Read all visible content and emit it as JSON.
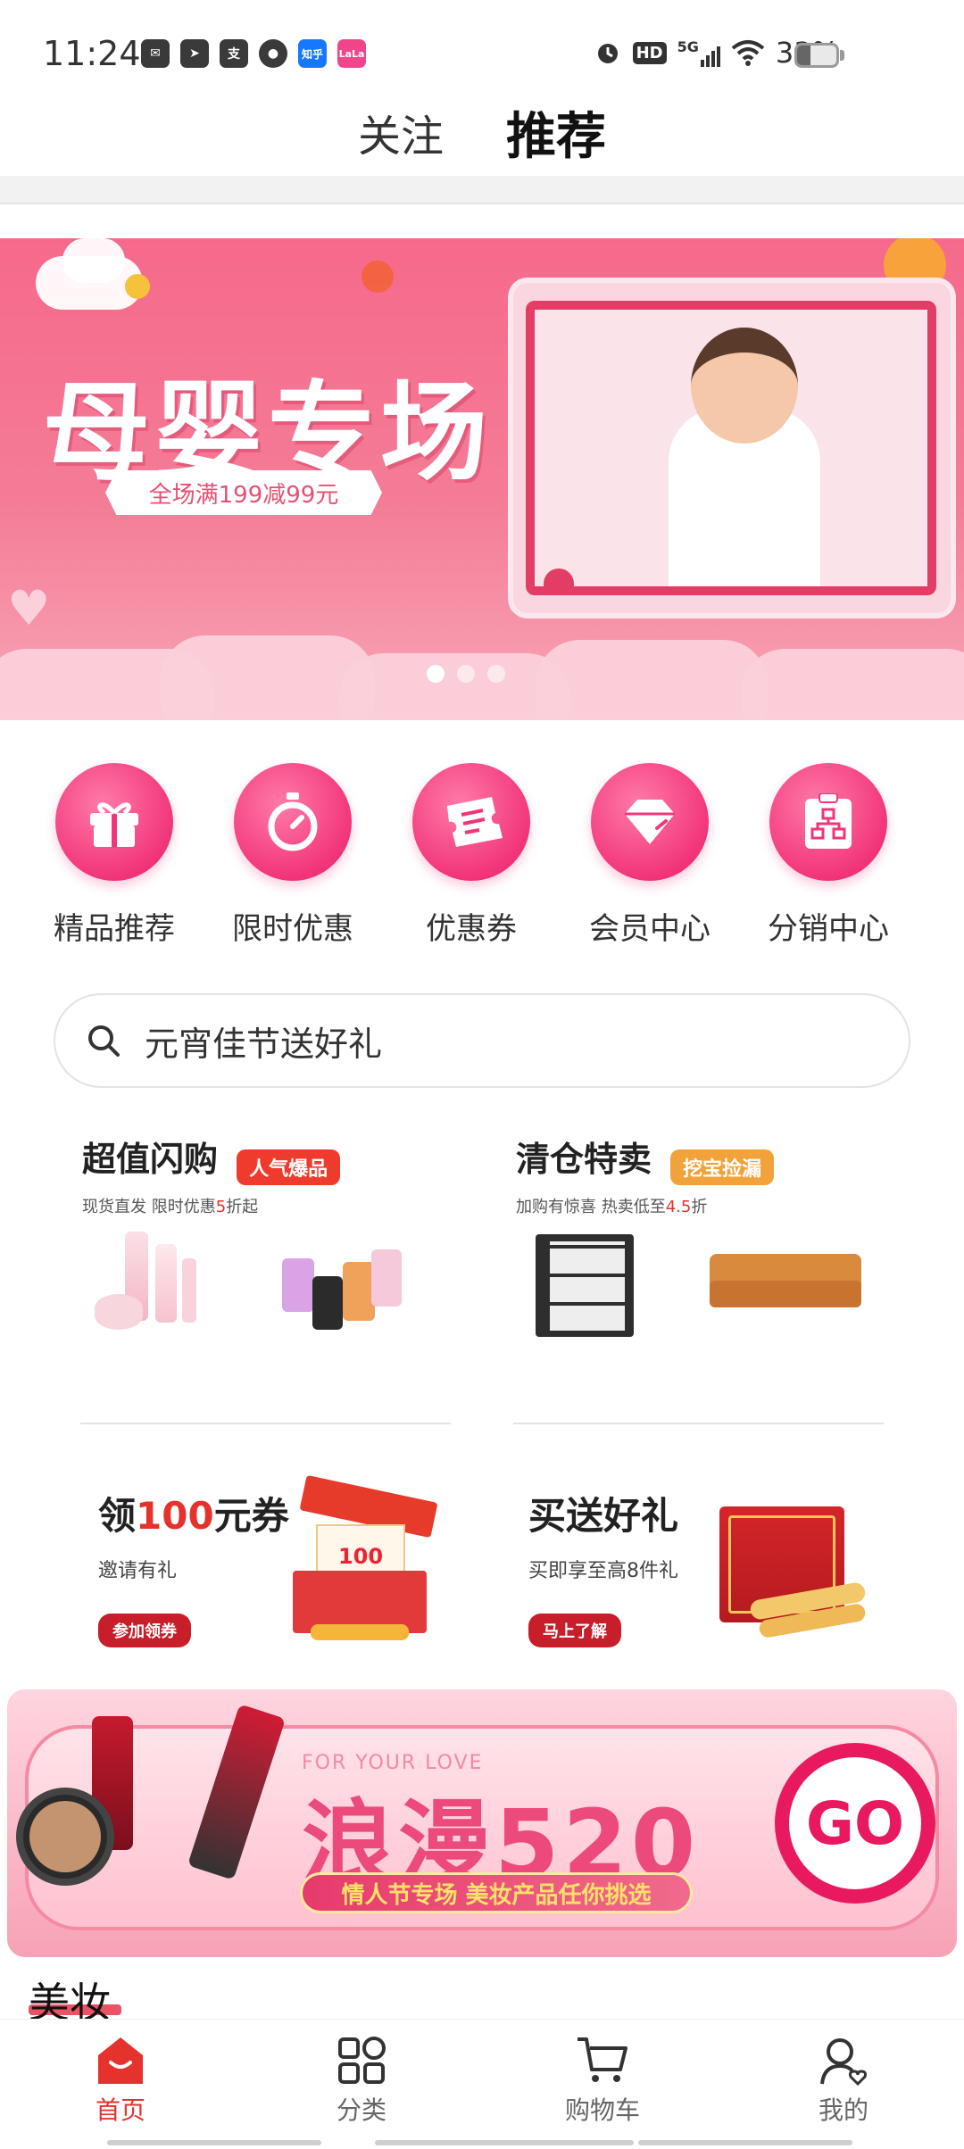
{
  "status_bar": {
    "time": "11:24",
    "apps": [
      "mail-icon",
      "telegram-icon",
      "alipay-icon",
      "browser-icon",
      "zhihu-icon",
      "lala-icon"
    ],
    "app_labels": {
      "alipay": "支",
      "zhihu": "知乎",
      "lala": "LaLa"
    },
    "network": "5G",
    "hd": "HD",
    "battery": "33%",
    "battery_level": 0.33
  },
  "top_tabs": [
    {
      "label": "关注",
      "active": false
    },
    {
      "label": "推荐",
      "active": true
    }
  ],
  "banner": {
    "title": "母婴专场",
    "ribbon": "全场满199减99元",
    "slide_count": 3,
    "active_slide": 0
  },
  "quick_menu": [
    {
      "label": "精品推荐",
      "icon": "gift-box-icon"
    },
    {
      "label": "限时优惠",
      "icon": "stopwatch-icon"
    },
    {
      "label": "优惠券",
      "icon": "ticket-icon"
    },
    {
      "label": "会员中心",
      "icon": "diamond-icon"
    },
    {
      "label": "分销中心",
      "icon": "org-chart-icon"
    }
  ],
  "search": {
    "placeholder": "元宵佳节送好礼"
  },
  "promos": [
    {
      "title": "超值闪购",
      "tag": "人气爆品",
      "tag_color": "#ef3b2d",
      "sub_prefix": "现货直发 限时优惠",
      "sub_highlight": "5",
      "sub_suffix": "折起"
    },
    {
      "title": "清仓特卖",
      "tag": "挖宝捡漏",
      "tag_color": "#f2a23a",
      "sub_prefix": "加购有惊喜  热卖低至",
      "sub_highlight": "4.5",
      "sub_suffix": "折"
    }
  ],
  "coupons": [
    {
      "title_prefix": "领",
      "title_highlight": "100",
      "title_suffix": "元券",
      "sub": "邀请有礼",
      "button": "参加领券",
      "img_amount": "100"
    },
    {
      "title": "买送好礼",
      "sub": "买即享至高8件礼",
      "button": "马上了解"
    }
  ],
  "banner520": {
    "small_text": "FOR YOUR LOVE",
    "title": "浪漫520",
    "ribbon": "情人节专场   美妆产品任你挑选",
    "go": "GO"
  },
  "section": {
    "title": "美妆"
  },
  "bottom_nav": [
    {
      "label": "首页",
      "icon": "home-icon",
      "active": true
    },
    {
      "label": "分类",
      "icon": "category-icon",
      "active": false
    },
    {
      "label": "购物车",
      "icon": "cart-icon",
      "active": false
    },
    {
      "label": "我的",
      "icon": "profile-icon",
      "active": false
    }
  ],
  "colors": {
    "accent": "#e5322d",
    "pink": "#f2357a"
  }
}
